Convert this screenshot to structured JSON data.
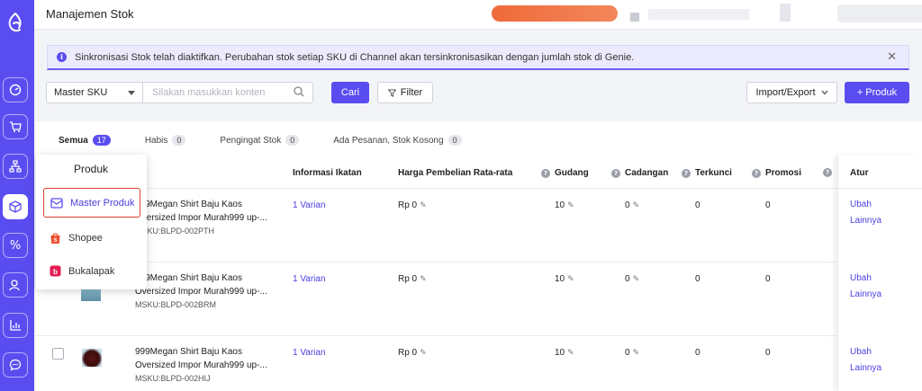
{
  "header": {
    "title": "Manajemen Stok"
  },
  "alert": {
    "text": "Sinkronisasi Stok telah diaktifkan. Perubahan stok setiap SKU di Channel akan tersinkronisasikan dengan jumlah stok di Genie."
  },
  "toolbar": {
    "select_value": "Master SKU",
    "search_placeholder": "Silakan masukkan konten",
    "search_label": "Cari",
    "filter_label": "Filter",
    "import_export_label": "Import/Export",
    "add_product_label": "+ Produk"
  },
  "tabs": [
    {
      "label": "Semua",
      "count": "17"
    },
    {
      "label": "Habis",
      "count": "0"
    },
    {
      "label": "Pengingat Stok",
      "count": "0"
    },
    {
      "label": "Ada Pesanan, Stok Kosong",
      "count": "0"
    }
  ],
  "table": {
    "columns": {
      "informasi_ikatan": "Informasi Ikatan",
      "harga": "Harga Pembelian Rata-rata",
      "gudang": "Gudang",
      "cadangan": "Cadangan",
      "terkunci": "Terkunci",
      "promosi": "Promosi",
      "atur": "Atur"
    },
    "rows": [
      {
        "name": "999Megan Shirt Baju Kaos Oversized Impor Murah999 up-...",
        "msku": "MSKU:BLPD-002PTH",
        "ikatan": "1 Varian",
        "harga": "Rp 0",
        "gudang": "10",
        "cadangan": "0",
        "terkunci": "0",
        "promosi": "0",
        "ubah": "Ubah",
        "lainnya": "Lainnya"
      },
      {
        "name": "999Megan Shirt Baju Kaos Oversized Impor Murah999 up-...",
        "msku": "MSKU:BLPD-002BRM",
        "ikatan": "1 Varian",
        "harga": "Rp 0",
        "gudang": "10",
        "cadangan": "0",
        "terkunci": "0",
        "promosi": "0",
        "ubah": "Ubah",
        "lainnya": "Lainnya"
      },
      {
        "name": "999Megan Shirt Baju Kaos Oversized Impor Murah999 up-...",
        "msku": "MSKU:BLPD-002HIJ",
        "ikatan": "1 Varian",
        "harga": "Rp 0",
        "gudang": "10",
        "cadangan": "0",
        "terkunci": "0",
        "promosi": "0",
        "ubah": "Ubah",
        "lainnya": "Lainnya"
      }
    ]
  },
  "popup": {
    "title": "Produk",
    "items": [
      {
        "label": "Master Produk",
        "icon": "box-icon"
      },
      {
        "label": "Shopee",
        "icon": "shopee-icon"
      },
      {
        "label": "Bukalapak",
        "icon": "bukalapak-icon"
      }
    ]
  },
  "colors": {
    "accent": "#5a4df0",
    "highlight": "#e2412c"
  }
}
